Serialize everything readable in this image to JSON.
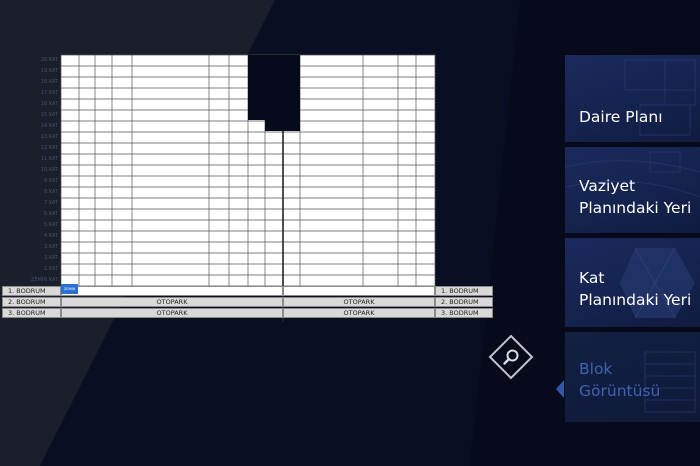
{
  "floors": [
    "20.KAT",
    "19.KAT",
    "18.KAT",
    "17.KAT",
    "16.KAT",
    "15.KAT",
    "14.KAT",
    "13.KAT",
    "12.KAT",
    "11.KAT",
    "10.KAT",
    "9.KAT",
    "8.KAT",
    "7.KAT",
    "6.KAT",
    "5.KAT",
    "4.KAT",
    "3.KAT",
    "2.KAT",
    "1.KAT",
    "ZEMIN KAT"
  ],
  "basements": [
    {
      "left_label": "1. BODRUM",
      "center_left": "",
      "center_right": "",
      "right_label": "1. BODRUM"
    },
    {
      "left_label": "2. BODRUM",
      "center_left": "OTOPARK",
      "center_right": "OTOPARK",
      "right_label": "2. BODRUM"
    },
    {
      "left_label": "3. BODRUM",
      "center_left": "OTOPARK",
      "center_right": "OTOPARK",
      "right_label": "3. BODRUM"
    }
  ],
  "selected_unit_label": "ZEMIN",
  "menu": [
    {
      "label": "Daire Planı",
      "active": false
    },
    {
      "label": "Vaziyet\nPlanındaki Yeri",
      "active": false
    },
    {
      "label": "Kat\nPlanındaki Yeri",
      "active": false
    },
    {
      "label": "Blok\nGörüntüsü",
      "active": true
    }
  ],
  "icons": {
    "zoom": "magnifier-icon"
  },
  "colors": {
    "accent": "#3158a8",
    "background": "#070a1b",
    "card": "#17275a"
  }
}
